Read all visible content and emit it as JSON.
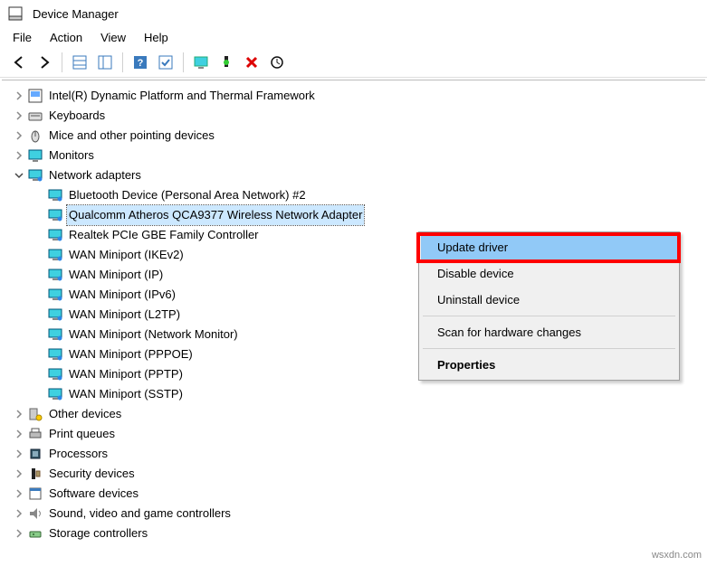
{
  "window": {
    "title": "Device Manager"
  },
  "menubar": [
    "File",
    "Action",
    "View",
    "Help"
  ],
  "toolbar_icons": [
    "back-icon",
    "forward-icon",
    "properties-grid-icon",
    "pane-icon",
    "help-icon",
    "update-icon",
    "monitor-icon",
    "connect-icon",
    "delete-icon",
    "scan-icon"
  ],
  "tree": [
    {
      "depth": 1,
      "toggle": ">",
      "icon": "device-frame",
      "label": "Intel(R) Dynamic Platform and Thermal Framework"
    },
    {
      "depth": 1,
      "toggle": ">",
      "icon": "keyboard",
      "label": "Keyboards"
    },
    {
      "depth": 1,
      "toggle": ">",
      "icon": "mouse",
      "label": "Mice and other pointing devices"
    },
    {
      "depth": 1,
      "toggle": ">",
      "icon": "monitor",
      "label": "Monitors"
    },
    {
      "depth": 1,
      "toggle": "v",
      "icon": "network",
      "label": "Network adapters"
    },
    {
      "depth": 2,
      "toggle": "",
      "icon": "network",
      "label": "Bluetooth Device (Personal Area Network) #2"
    },
    {
      "depth": 2,
      "toggle": "",
      "icon": "network",
      "label": "Qualcomm Atheros QCA9377 Wireless Network Adapter",
      "selected": true
    },
    {
      "depth": 2,
      "toggle": "",
      "icon": "network",
      "label": "Realtek PCIe GBE Family Controller"
    },
    {
      "depth": 2,
      "toggle": "",
      "icon": "network",
      "label": "WAN Miniport (IKEv2)"
    },
    {
      "depth": 2,
      "toggle": "",
      "icon": "network",
      "label": "WAN Miniport (IP)"
    },
    {
      "depth": 2,
      "toggle": "",
      "icon": "network",
      "label": "WAN Miniport (IPv6)"
    },
    {
      "depth": 2,
      "toggle": "",
      "icon": "network",
      "label": "WAN Miniport (L2TP)"
    },
    {
      "depth": 2,
      "toggle": "",
      "icon": "network",
      "label": "WAN Miniport (Network Monitor)"
    },
    {
      "depth": 2,
      "toggle": "",
      "icon": "network",
      "label": "WAN Miniport (PPPOE)"
    },
    {
      "depth": 2,
      "toggle": "",
      "icon": "network",
      "label": "WAN Miniport (PPTP)"
    },
    {
      "depth": 2,
      "toggle": "",
      "icon": "network",
      "label": "WAN Miniport (SSTP)"
    },
    {
      "depth": 1,
      "toggle": ">",
      "icon": "other",
      "label": "Other devices"
    },
    {
      "depth": 1,
      "toggle": ">",
      "icon": "printer",
      "label": "Print queues"
    },
    {
      "depth": 1,
      "toggle": ">",
      "icon": "cpu",
      "label": "Processors"
    },
    {
      "depth": 1,
      "toggle": ">",
      "icon": "security",
      "label": "Security devices"
    },
    {
      "depth": 1,
      "toggle": ">",
      "icon": "software",
      "label": "Software devices"
    },
    {
      "depth": 1,
      "toggle": ">",
      "icon": "sound",
      "label": "Sound, video and game controllers"
    },
    {
      "depth": 1,
      "toggle": ">",
      "icon": "storage",
      "label": "Storage controllers"
    }
  ],
  "context_menu": {
    "update": "Update driver",
    "disable": "Disable device",
    "uninstall": "Uninstall device",
    "scan": "Scan for hardware changes",
    "properties": "Properties"
  },
  "watermark": "wsxdn.com"
}
